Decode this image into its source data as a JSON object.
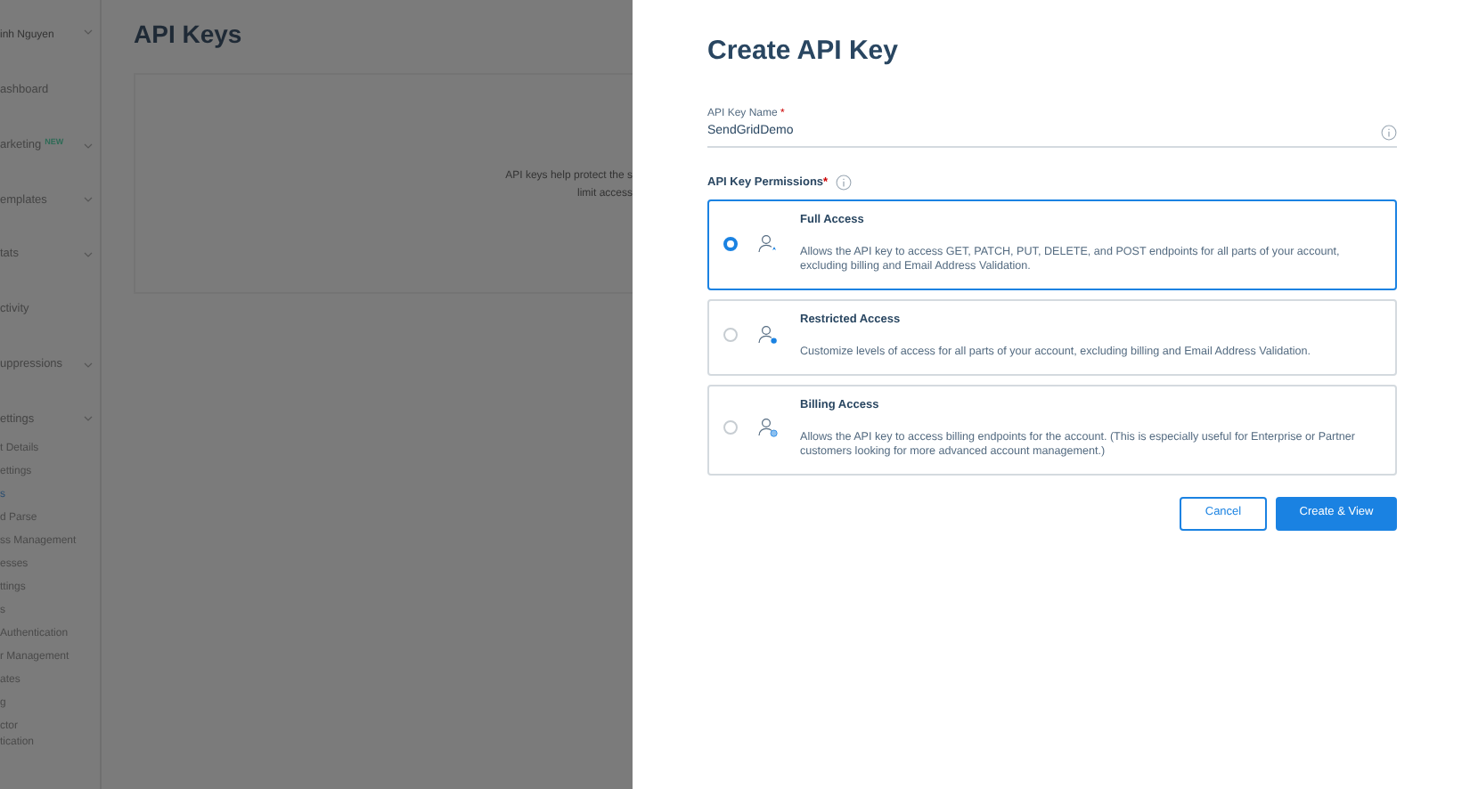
{
  "sidebar": {
    "user": "inh Nguyen",
    "items": [
      {
        "label": "ashboard",
        "expandable": false
      },
      {
        "label": "arketing",
        "badge": "NEW",
        "expandable": true
      },
      {
        "label": "emplates",
        "expandable": true
      },
      {
        "label": "tats",
        "expandable": true
      },
      {
        "label": "ctivity",
        "expandable": false
      },
      {
        "label": "uppressions",
        "expandable": true
      },
      {
        "label": "ettings",
        "expandable": true
      }
    ],
    "subitems": [
      {
        "label": "t Details",
        "selected": false
      },
      {
        "label": "ettings",
        "selected": false
      },
      {
        "label": "s",
        "selected": true
      },
      {
        "label": "d Parse",
        "selected": false
      },
      {
        "label": "ss Management",
        "selected": false
      },
      {
        "label": "esses",
        "selected": false
      },
      {
        "label": "ttings",
        "selected": false
      },
      {
        "label": "s",
        "selected": false
      },
      {
        "label": "Authentication",
        "selected": false
      },
      {
        "label": "r Management",
        "selected": false
      },
      {
        "label": "ates",
        "selected": false
      },
      {
        "label": "g",
        "selected": false
      },
      {
        "label": "ctor\ntication",
        "selected": false
      }
    ]
  },
  "page": {
    "title": "API Keys",
    "empty_text": [
      "API keys help protect the s",
      "limit access"
    ]
  },
  "drawer": {
    "title": "Create API Key",
    "name_field": {
      "label": "API Key Name",
      "required_mark": "*",
      "value": "SendGridDemo"
    },
    "permissions_label": "API Key Permissions",
    "permissions_required_mark": "*",
    "options": [
      {
        "title": "Full Access",
        "description": "Allows the API key to access GET, PATCH, PUT, DELETE, and POST endpoints for all parts of your account, excluding billing and Email Address Validation.",
        "selected": true,
        "kind": "star"
      },
      {
        "title": "Restricted Access",
        "description": "Customize levels of access for all parts of your account, excluding billing and Email Address Validation.",
        "selected": false,
        "kind": "dot"
      },
      {
        "title": "Billing Access",
        "description": "Allows the API key to access billing endpoints for the account. (This is especially useful for Enterprise or Partner customers looking for more advanced account management.)",
        "selected": false,
        "kind": "coin"
      }
    ],
    "buttons": [
      {
        "label": "Cancel",
        "kind": "secondary"
      },
      {
        "label": "Create & View",
        "kind": "primary"
      }
    ]
  }
}
